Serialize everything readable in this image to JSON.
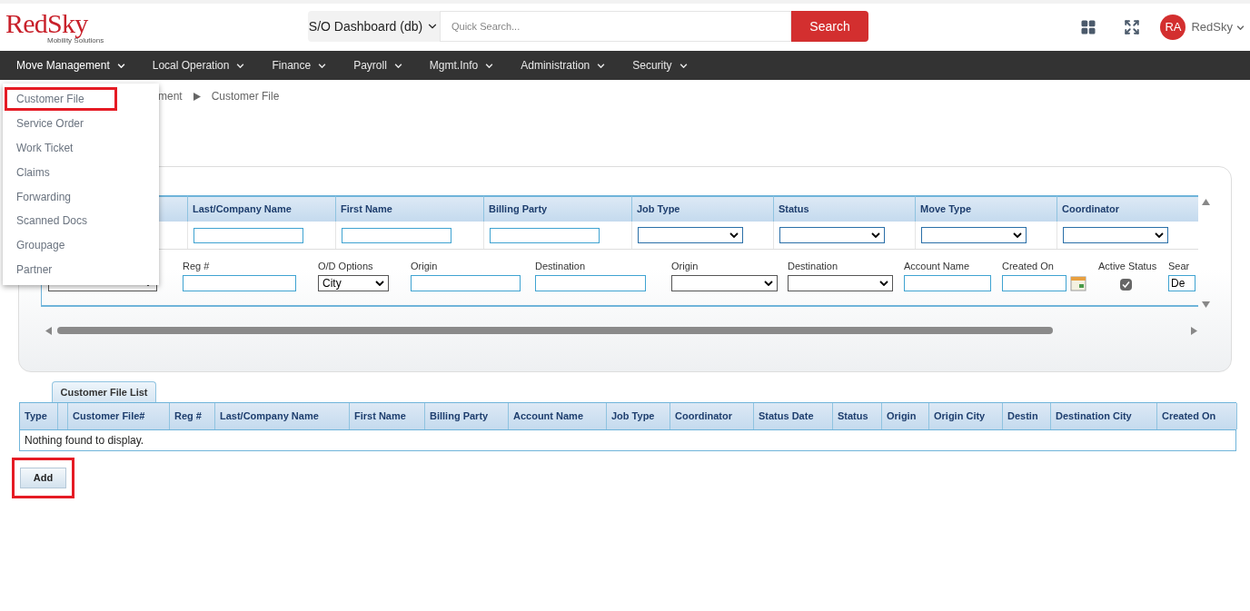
{
  "logo": {
    "name": "RedSky",
    "tagline": "Mobility Solutions"
  },
  "header": {
    "dashboard_select": "S/O Dashboard (db)",
    "search": {
      "placeholder": "Quick Search..."
    },
    "search_button": "Search",
    "user": {
      "initials": "RA",
      "name": "RedSky"
    }
  },
  "nav": [
    {
      "label": "Move Management",
      "selected": true
    },
    {
      "label": "Local Operation",
      "selected": false
    },
    {
      "label": "Finance",
      "selected": false
    },
    {
      "label": "Payroll",
      "selected": false
    },
    {
      "label": "Mgmt.Info",
      "selected": false
    },
    {
      "label": "Administration",
      "selected": false
    },
    {
      "label": "Security",
      "selected": false
    }
  ],
  "dropdown": [
    {
      "label": "Customer File",
      "highlighted": true
    },
    {
      "label": "Service Order",
      "highlighted": false
    },
    {
      "label": "Work Ticket",
      "highlighted": false
    },
    {
      "label": "Claims",
      "highlighted": false
    },
    {
      "label": "Forwarding",
      "highlighted": false
    },
    {
      "label": "Scanned Docs",
      "highlighted": false
    },
    {
      "label": "Groupage",
      "highlighted": false
    },
    {
      "label": "Partner",
      "highlighted": false
    }
  ],
  "breadcrumb": [
    "ment",
    "Customer File"
  ],
  "search_grid": {
    "columns": [
      {
        "kind": "blank"
      },
      {
        "label": "Last/Company Name",
        "kind": "text"
      },
      {
        "label": "First Name",
        "kind": "text"
      },
      {
        "label": "Billing Party",
        "kind": "text"
      },
      {
        "label": "Job Type",
        "kind": "select"
      },
      {
        "label": "Status",
        "kind": "select"
      },
      {
        "label": "Move Type",
        "kind": "select"
      },
      {
        "label": "Coordinator",
        "kind": "select"
      }
    ],
    "fields": [
      {
        "kind": "select"
      },
      {
        "kind": "text",
        "label": "Reg #"
      },
      {
        "kind": "select",
        "label": "O/D Options",
        "value": "City"
      },
      {
        "kind": "text",
        "label": "Origin"
      },
      {
        "kind": "text",
        "label": "Destination"
      },
      {
        "kind": "select",
        "label": "Origin"
      },
      {
        "kind": "select",
        "label": "Destination"
      },
      {
        "kind": "text",
        "label": "Account Name"
      },
      {
        "kind": "date",
        "label": "Created On"
      },
      {
        "kind": "checkbox",
        "label": "Active Status",
        "checked": true
      },
      {
        "kind": "text",
        "label": "Sear",
        "value": "De"
      }
    ]
  },
  "list": {
    "tab": "Customer File List",
    "columns": [
      "Type",
      "",
      "Customer File#",
      "Reg #",
      "Last/Company Name",
      "First Name",
      "Billing Party",
      "Account Name",
      "Job Type",
      "Coordinator",
      "Status Date",
      "Status",
      "Origin",
      "Origin City",
      "Destin",
      "Destination City",
      "Created On"
    ],
    "empty": "Nothing found to display.",
    "add_button": {
      "label": "Add",
      "highlighted": true
    }
  }
}
